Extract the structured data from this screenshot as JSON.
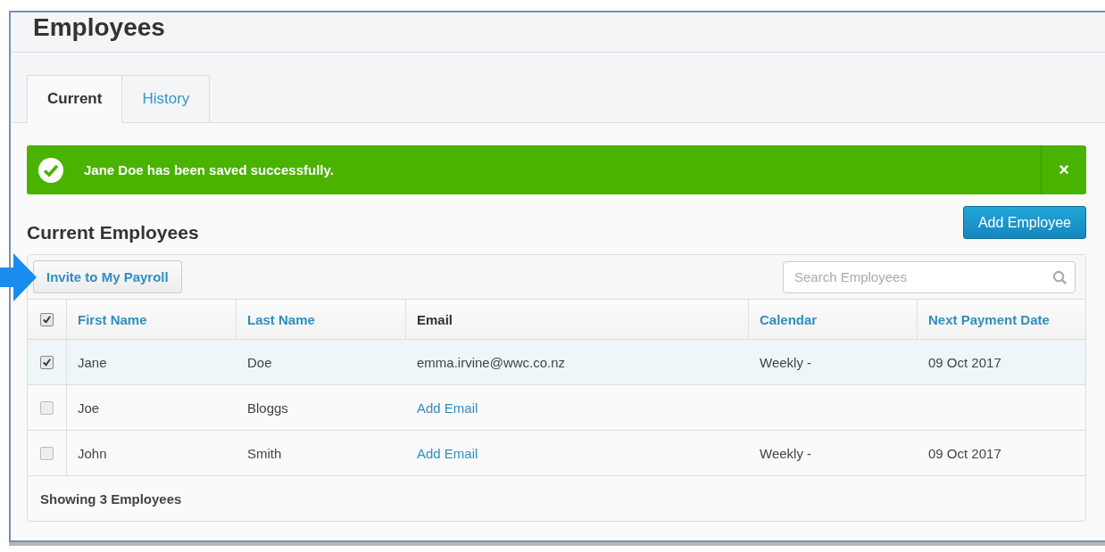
{
  "page": {
    "title": "Employees"
  },
  "tabs": [
    {
      "label": "Current",
      "selected": true
    },
    {
      "label": "History",
      "selected": false
    }
  ],
  "alert": {
    "message": "Jane Doe has been saved successfully.",
    "close": "×"
  },
  "section": {
    "title": "Current Employees"
  },
  "add_button": "Add Employee",
  "invite_button": "Invite to My Payroll",
  "search": {
    "placeholder": "Search Employees"
  },
  "table": {
    "all_checked": true,
    "columns": [
      {
        "label": "First Name",
        "sortable": true
      },
      {
        "label": "Last Name",
        "sortable": true
      },
      {
        "label": "Email",
        "sortable": false
      },
      {
        "label": "Calendar",
        "sortable": true
      },
      {
        "label": "Next Payment Date",
        "sortable": true
      }
    ],
    "rows": [
      {
        "checked": true,
        "selected": true,
        "cells": [
          {
            "kind": "text",
            "text": "Jane"
          },
          {
            "kind": "text",
            "text": "Doe"
          },
          {
            "kind": "text",
            "text": "emma.irvine@wwc.co.nz"
          },
          {
            "kind": "text",
            "text": "Weekly -"
          },
          {
            "kind": "text",
            "text": "09 Oct 2017"
          }
        ]
      },
      {
        "checked": false,
        "selected": false,
        "cells": [
          {
            "kind": "text",
            "text": "Joe"
          },
          {
            "kind": "text",
            "text": "Bloggs"
          },
          {
            "kind": "link",
            "text": "Add Email"
          },
          {
            "kind": "empty"
          },
          {
            "kind": "empty"
          }
        ]
      },
      {
        "checked": false,
        "selected": false,
        "cells": [
          {
            "kind": "text",
            "text": "John"
          },
          {
            "kind": "text",
            "text": "Smith"
          },
          {
            "kind": "link",
            "text": "Add Email"
          },
          {
            "kind": "text",
            "text": "Weekly -"
          },
          {
            "kind": "text",
            "text": "09 Oct 2017"
          }
        ]
      }
    ],
    "footer": "Showing 3 Employees"
  }
}
